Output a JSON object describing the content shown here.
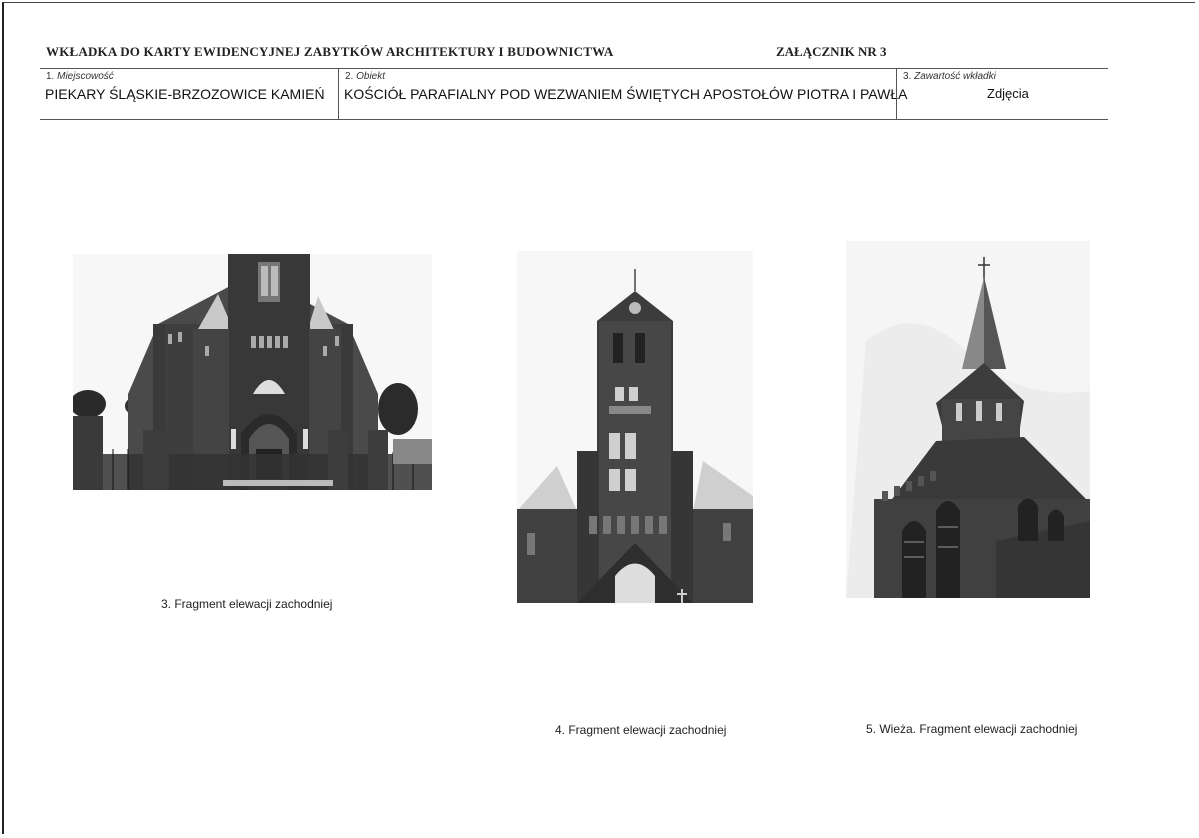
{
  "header": {
    "title": "WKŁADKA DO KARTY EWIDENCYJNEJ ZABYTKÓW ARCHITEKTURY I BUDOWNICTWA",
    "annex": "ZAŁĄCZNIK NR 3"
  },
  "fields": [
    {
      "num": "1.",
      "label": "Miejscowość",
      "value": "PIEKARY ŚLĄSKIE-BRZOZOWICE KAMIEŃ"
    },
    {
      "num": "2.",
      "label": "Obiekt",
      "value": "KOŚCIÓŁ PARAFIALNY POD WEZWANIEM ŚWIĘTYCH APOSTOŁÓW PIOTRA I PAWŁA"
    },
    {
      "num": "3.",
      "label": "Zawartość wkładki",
      "value": "Zdjęcia"
    }
  ],
  "photos": [
    {
      "caption": "3.  Fragment elewacji zachodniej"
    },
    {
      "caption": "4.  Fragment elewacji zachodniej"
    },
    {
      "caption": "5.  Wieża. Fragment elewacji zachodniej"
    }
  ]
}
